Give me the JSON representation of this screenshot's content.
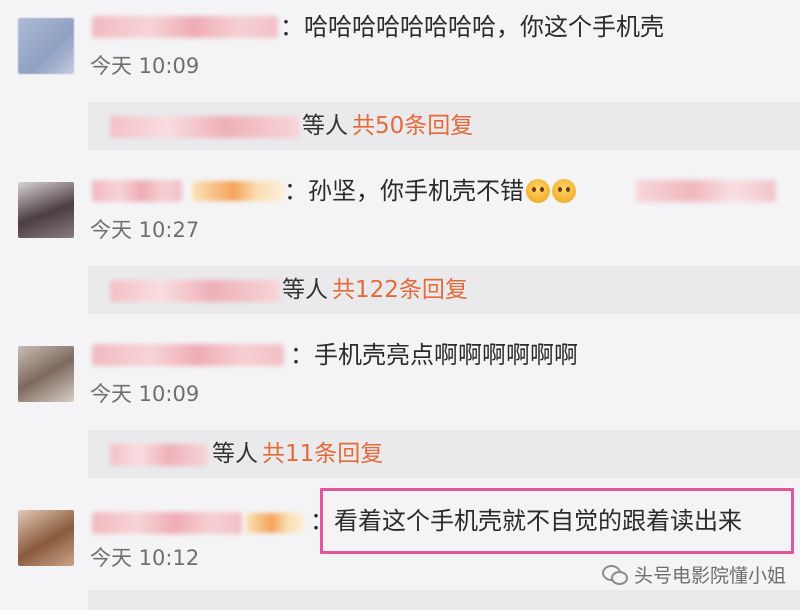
{
  "comments": [
    {
      "text": "：哈哈哈哈哈哈哈哈，你这个手机壳",
      "time": "今天 10:09",
      "reply": {
        "who": "等人",
        "count": "共50条回复"
      }
    },
    {
      "text": "：孙坚，你手机壳不错",
      "time": "今天 10:27",
      "reply": {
        "who": "等人",
        "count": "共122条回复"
      }
    },
    {
      "text": "：手机壳亮点啊啊啊啊啊啊",
      "time": "今天 10:09",
      "reply": {
        "who": "等人",
        "count": "共11条回复"
      }
    },
    {
      "text": "：看着这个手机壳就不自觉的跟着读出来",
      "time": "今天 10:12"
    }
  ],
  "icons": {
    "emoji": "scared-face-emoji",
    "watermark": "wechat-icon"
  },
  "colors": {
    "reply_count": "#e36a3a",
    "highlight": "#e2559b",
    "background": "#f4f4f6"
  },
  "watermark": {
    "text": "头号电影院懂小姐"
  }
}
